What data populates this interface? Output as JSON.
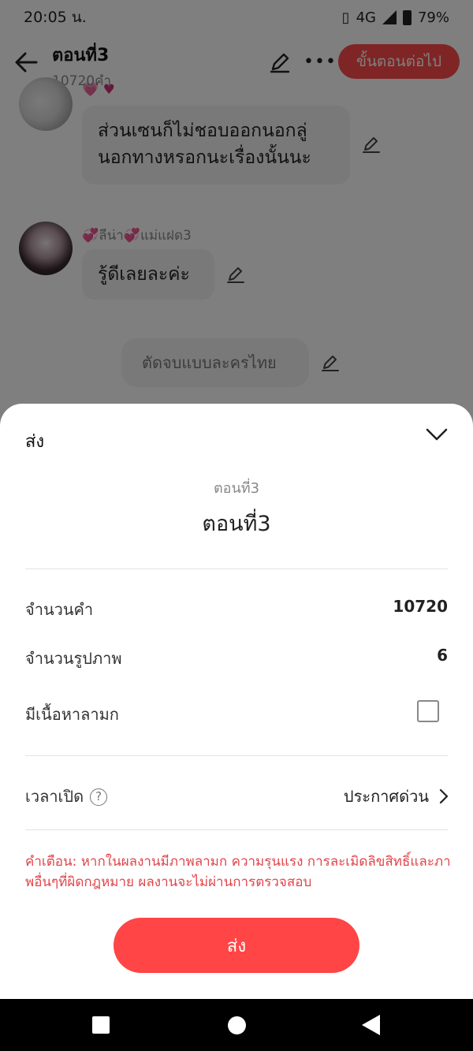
{
  "status_bar": {
    "time": "20:05 น.",
    "network": "4G",
    "battery": "79%"
  },
  "header": {
    "title": "ตอนที่3",
    "word_count": "10720คำ",
    "next_button": "ขั้นตอนต่อไป"
  },
  "chat": {
    "msg1_text": "ส่วนเซนก็ไม่ชอบออกนอกลู่นอกทางหรอกนะเรื่องนั้นนะ",
    "sender2_name": "ลีน่า",
    "sender2_suffix": "แม่แฝด3",
    "msg2_text": "รู้ดีเลยละค่ะ",
    "narration_text": "ตัดจบแบบละครไทย"
  },
  "sheet": {
    "title": "ส่ง",
    "chapter_subtitle": "ตอนที่3",
    "chapter_title": "ตอนที่3",
    "word_count_label": "จำนวนคำ",
    "word_count_value": "10720",
    "image_count_label": "จำนวนรูปภาพ",
    "image_count_value": "6",
    "adult_label": "มีเนื้อหาลามก",
    "adult_checked": false,
    "open_time_label": "เวลาเปิด",
    "open_time_value": "ประกาศด่วน",
    "warning": "คำเตือน: หากในผลงานมีภาพลามก ความรุนแรง การละเมิดลิขสิทธิ์และภาพอื่นๆที่ผิดกฎหมาย ผลงานจะไม่ผ่านการตรวจสอบ",
    "send_button": "ส่ง"
  },
  "colors": {
    "accent": "#ff4545",
    "warning": "#e0454a"
  }
}
